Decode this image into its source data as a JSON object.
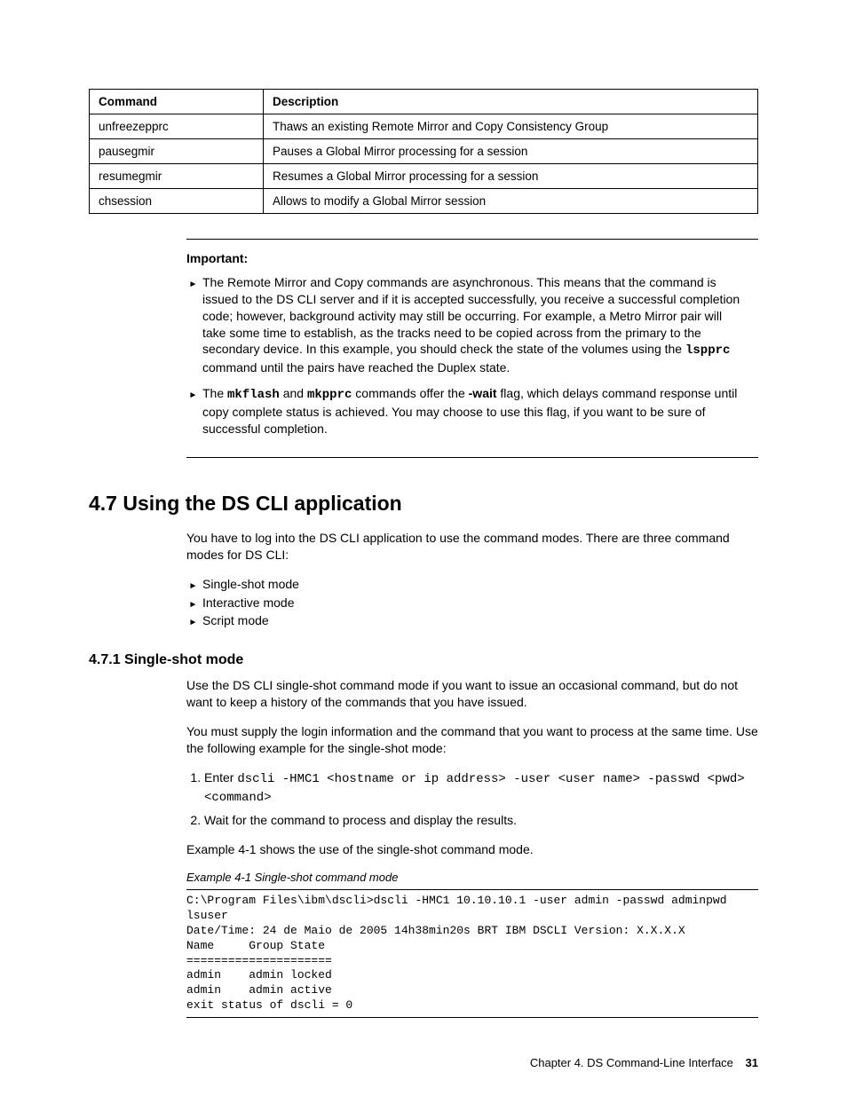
{
  "table": {
    "headers": [
      "Command",
      "Description"
    ],
    "rows": [
      [
        "unfreezepprc",
        "Thaws an existing Remote Mirror and Copy Consistency Group"
      ],
      [
        "pausegmir",
        "Pauses a Global Mirror processing for a session"
      ],
      [
        "resumegmir",
        "Resumes a Global Mirror processing for a session"
      ],
      [
        "chsession",
        "Allows to modify a Global Mirror session"
      ]
    ]
  },
  "note": {
    "title": "Important:",
    "item1_a": "The Remote Mirror and Copy commands are asynchronous. This means that the command is issued to the DS CLI server and if it is accepted successfully, you receive a successful completion code; however, background activity may still be occurring. For example, a Metro Mirror pair will take some time to establish, as the tracks need to be copied across from the primary to the secondary device. In this example, you should check the state of the volumes using the ",
    "item1_code": "lspprc",
    "item1_b": " command until the pairs have reached the Duplex state.",
    "item2_a": "The ",
    "item2_code1": "mkflash",
    "item2_mid": " and ",
    "item2_code2": "mkpprc",
    "item2_b": " commands offer the ",
    "item2_flag": "-wait",
    "item2_c": " flag, which delays command response until copy complete status is achieved. You may choose to use this flag, if you want to be sure of successful completion."
  },
  "section": {
    "num_title": "4.7  Using the DS CLI application",
    "intro": "You have to log into the DS CLI application to use the command modes. There are three command modes for DS CLI:",
    "modes": [
      "Single-shot mode",
      "Interactive mode",
      "Script mode"
    ]
  },
  "subsection": {
    "num_title": "4.7.1  Single-shot mode",
    "p1": "Use the DS CLI single-shot command mode if you want to issue an occasional command, but do not want to keep a history of the commands that you have issued.",
    "p2": "You must supply the login information and the command that you want to process at the same time. Use the following example for the single-shot mode:",
    "step1_lead": "Enter ",
    "step1_code": "dscli -HMC1 <hostname or ip address> -user <user name> -passwd <pwd> <command>",
    "step2": "Wait for the command to process and display the results.",
    "p3": "Example 4-1 shows the use of the single-shot command mode.",
    "example_caption": "Example 4-1   Single-shot command mode",
    "example_code": "C:\\Program Files\\ibm\\dscli>dscli -HMC1 10.10.10.1 -user admin -passwd adminpwd\nlsuser\nDate/Time: 24 de Maio de 2005 14h38min20s BRT IBM DSCLI Version: X.X.X.X\nName     Group State\n=====================\nadmin    admin locked\nadmin    admin active\nexit status of dscli = 0"
  },
  "footer": {
    "chapter": "Chapter 4. DS Command-Line Interface",
    "page": "31"
  }
}
